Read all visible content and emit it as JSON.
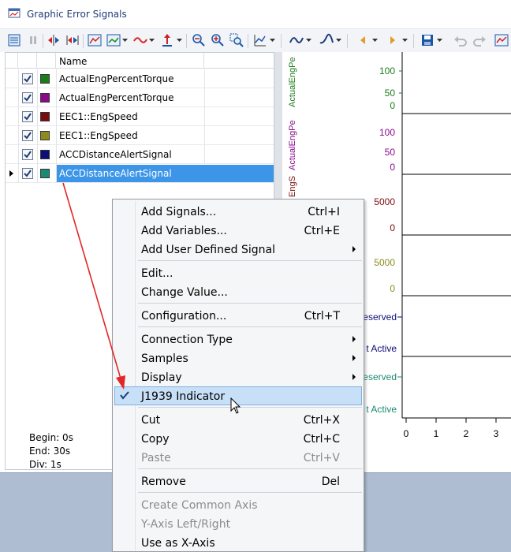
{
  "window": {
    "title": "Graphic Error Signals"
  },
  "toolbar": {
    "icons": [
      "signal-list-icon",
      "pause-icon",
      "zoom-x-icon",
      "fit-x-icon",
      "chart-icon",
      "chart-options-icon",
      "wave-icon",
      "axis-icon",
      "zoom-out-icon",
      "zoom-in-icon",
      "zoom-box-icon",
      "chart-type-icon",
      "curve-icon",
      "curve-alt-icon",
      "prev-icon",
      "next-icon",
      "save-icon",
      "undo-icon",
      "redo-icon",
      "layout-icon"
    ]
  },
  "signal_list": {
    "column_name": "Name",
    "rows": [
      {
        "label": "ActualEngPercentTorque",
        "color": "#1a7d1a",
        "checked": true
      },
      {
        "label": "ActualEngPercentTorque",
        "color": "#8b0a8b",
        "checked": true
      },
      {
        "label": "EEC1::EngSpeed",
        "color": "#7a0d0d",
        "checked": true
      },
      {
        "label": "EEC1::EngSpeed",
        "color": "#8d8a1e",
        "checked": true
      },
      {
        "label": "ACCDistanceAlertSignal",
        "color": "#0d0d7a",
        "checked": true
      },
      {
        "label": "ACCDistanceAlertSignal",
        "color": "#1a8a72",
        "checked": true
      }
    ]
  },
  "time_info": {
    "begin": "Begin: 0s",
    "end": "End: 30s",
    "div": "Div: 1s"
  },
  "chart": {
    "axis_labels": [
      "ActualEngPe",
      "ActualEngPe",
      "EngS"
    ],
    "ticks": {
      "p1": [
        "100",
        "50",
        "0"
      ],
      "p2": [
        "100",
        "50",
        "0"
      ],
      "p3": [
        "5000",
        "0"
      ],
      "p4": [
        "5000",
        "0"
      ],
      "p5": [
        "eserved",
        "t Active"
      ],
      "p6": [
        "eserved",
        "t Active"
      ]
    },
    "x_ticks": [
      "0",
      "1",
      "2",
      "3"
    ],
    "colors": [
      "#1a7d1a",
      "#8b0a8b",
      "#7a0d0d",
      "#8d8a1e",
      "#0d0d7a",
      "#1a8a72"
    ]
  },
  "context_menu": {
    "items": [
      {
        "label": "Add Signals...",
        "shortcut": "Ctrl+I"
      },
      {
        "label": "Add Variables...",
        "shortcut": "Ctrl+E"
      },
      {
        "label": "Add User Defined Signal",
        "shortcut": ""
      },
      {
        "label": "Edit...",
        "shortcut": ""
      },
      {
        "label": "Change Value...",
        "shortcut": ""
      },
      {
        "label": "Configuration...",
        "shortcut": "Ctrl+T"
      },
      {
        "label": "Connection Type",
        "shortcut": ""
      },
      {
        "label": "Samples",
        "shortcut": ""
      },
      {
        "label": "Display",
        "shortcut": ""
      },
      {
        "label": "J1939 Indicator",
        "shortcut": ""
      },
      {
        "label": "Cut",
        "shortcut": "Ctrl+X"
      },
      {
        "label": "Copy",
        "shortcut": "Ctrl+C"
      },
      {
        "label": "Paste",
        "shortcut": "Ctrl+V"
      },
      {
        "label": "Remove",
        "shortcut": "Del"
      },
      {
        "label": "Create Common Axis",
        "shortcut": ""
      },
      {
        "label": "Y-Axis Left/Right",
        "shortcut": ""
      },
      {
        "label": "Use as X-Axis",
        "shortcut": ""
      }
    ]
  }
}
